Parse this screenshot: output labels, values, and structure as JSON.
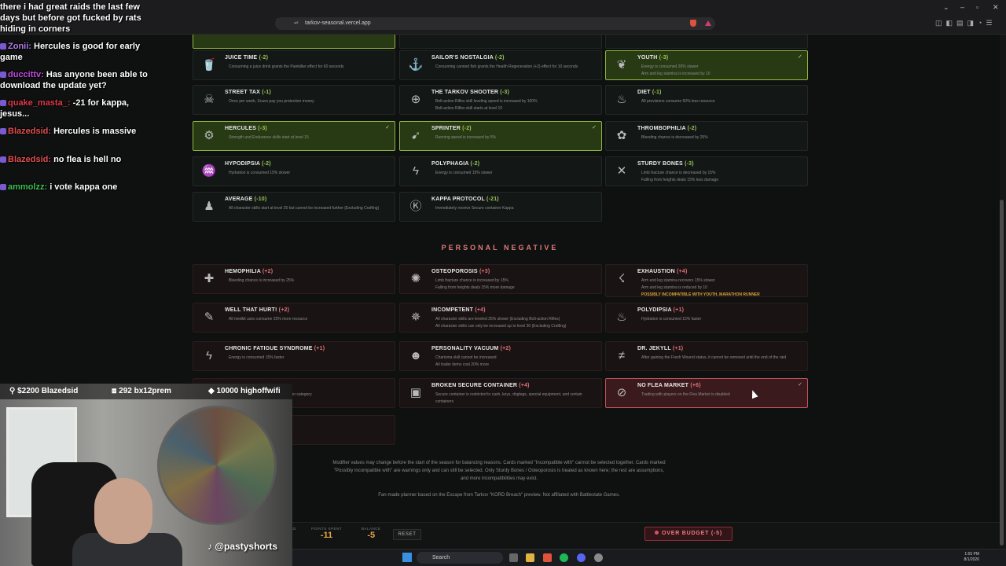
{
  "browser": {
    "url": "tarkov-seasonal.vercel.app"
  },
  "positive_cards": [
    {
      "name": "JUICE TIME",
      "cost": "(-2)",
      "desc": "Consuming a juice drink grants the Painkiller effect for 60 seconds",
      "selected": false,
      "icon": "juice-icon",
      "glyph": "🥤"
    },
    {
      "name": "SAILOR'S NOSTALGIA",
      "cost": "(-2)",
      "desc": "Consuming canned fish grants the Health Regeneration (+2) effect for 10 seconds",
      "selected": false,
      "icon": "anchor-icon",
      "glyph": "⚓"
    },
    {
      "name": "YOUTH",
      "cost": "(-3)",
      "desc": "Energy is consumed 20% slower\nArm and leg stamina is increased by 10",
      "selected": true,
      "icon": "plant-icon",
      "glyph": "❦"
    },
    {
      "name": "STREET TAX",
      "cost": "(-1)",
      "desc": "Once per week, Scavs pay you protection money",
      "selected": false,
      "icon": "scav-icon",
      "glyph": "☠"
    },
    {
      "name": "THE TARKOV SHOOTER",
      "cost": "(-3)",
      "desc": "Bolt-action Rifles skill leveling speed is increased by 100%\nBolt-action Rifles skill starts at level 10",
      "selected": false,
      "icon": "crosshair-icon",
      "glyph": "⊕"
    },
    {
      "name": "DIET",
      "cost": "(-1)",
      "desc": "All provisions consume 50% less resource",
      "selected": false,
      "icon": "food-icon",
      "glyph": "♨"
    },
    {
      "name": "HERCULES",
      "cost": "(-3)",
      "desc": "Strength and Endurance skills start at level 15",
      "selected": true,
      "icon": "muscle-icon",
      "glyph": "⚙"
    },
    {
      "name": "SPRINTER",
      "cost": "(-2)",
      "desc": "Running speed is increased by 5%",
      "selected": true,
      "icon": "runner-icon",
      "glyph": "➹"
    },
    {
      "name": "THROMBOPHILIA",
      "cost": "(-2)",
      "desc": "Bleeding chance is decreased by 25%",
      "selected": false,
      "icon": "blood-icon",
      "glyph": "✿"
    },
    {
      "name": "HYPODIPSIA",
      "cost": "(-2)",
      "desc": "Hydration is consumed 15% slower",
      "selected": false,
      "icon": "water-icon",
      "glyph": "♒"
    },
    {
      "name": "POLYPHAGIA",
      "cost": "(-2)",
      "desc": "Energy is consumed 15% slower",
      "selected": false,
      "icon": "lightning-icon",
      "glyph": "ϟ"
    },
    {
      "name": "STURDY BONES",
      "cost": "(-3)",
      "desc": "Limb fracture chance is decreased by 15%\nFalling from heights deals 15% less damage",
      "selected": false,
      "icon": "bones-icon",
      "glyph": "✕"
    },
    {
      "name": "AVERAGE",
      "cost": "(-10)",
      "desc": "All character skills start at level 25 but cannot be increased further (Excluding Crafting)",
      "selected": false,
      "icon": "person-icon",
      "glyph": "♟"
    },
    {
      "name": "KAPPA PROTOCOL",
      "cost": "(-21)",
      "desc": "Immediately receive Secure container Kappa",
      "selected": false,
      "icon": "kappa-icon",
      "glyph": "Ⓚ"
    }
  ],
  "section_title": "PERSONAL NEGATIVE",
  "negative_cards": [
    {
      "name": "HEMOPHILIA",
      "cost": "(+2)",
      "desc": "Bleeding chance is increased by 25%",
      "selected": false,
      "icon": "blood-drop-icon",
      "glyph": "✚",
      "warn": ""
    },
    {
      "name": "OSTEOPOROSIS",
      "cost": "(+3)",
      "desc": "Limb fracture chance is increased by 15%\nFalling from heights deals 15% more damage",
      "selected": false,
      "icon": "bone-icon",
      "glyph": "✺",
      "warn": ""
    },
    {
      "name": "EXHAUSTION",
      "cost": "(+4)",
      "desc": "Arm and leg stamina recovers 15% slower\nArm and leg stamina is reduced by 10",
      "selected": false,
      "icon": "tired-icon",
      "glyph": "☇",
      "warn": "POSSIBLY INCOMPATIBLE WITH YOUTH, MARATHON RUNNER"
    },
    {
      "name": "WELL THAT HURT!",
      "cost": "(+2)",
      "desc": "All medkit uses consume 25% more resource",
      "selected": false,
      "icon": "bandage-icon",
      "glyph": "✎",
      "warn": ""
    },
    {
      "name": "INCOMPETENT",
      "cost": "(+4)",
      "desc": "All character skills are leveled 25% slower (Excluding Bolt-action Rifles)\nAll character skills can only be increased up to level 30 (Excluding Crafting)",
      "selected": false,
      "icon": "gear-brain-icon",
      "glyph": "✵",
      "warn": ""
    },
    {
      "name": "POLYDIPSIA",
      "cost": "(+1)",
      "desc": "Hydration is consumed 15% faster",
      "selected": false,
      "icon": "thirst-icon",
      "glyph": "♨",
      "warn": ""
    },
    {
      "name": "CHRONIC FATIGUE SYNDROME",
      "cost": "(+1)",
      "desc": "Energy is consumed 15% faster",
      "selected": false,
      "icon": "fatigue-icon",
      "glyph": "ϟ",
      "warn": ""
    },
    {
      "name": "PERSONALITY VACUUM",
      "cost": "(+2)",
      "desc": "Charisma skill cannot be increased\nAll trader items cost 20% more",
      "selected": false,
      "icon": "mask-icon",
      "glyph": "☻",
      "warn": ""
    },
    {
      "name": "DR. JEKYLL",
      "cost": "(+1)",
      "desc": "After gaining the Fresh Wound status, it cannot be removed until the end of the raid",
      "selected": false,
      "icon": "wound-icon",
      "glyph": "≠",
      "warn": ""
    },
    {
      "name": "",
      "cost": "",
      "desc": "ems from the Provisions or Medication category",
      "selected": false,
      "icon": "hidden-card-icon",
      "glyph": "",
      "warn": ""
    },
    {
      "name": "BROKEN SECURE CONTAINER",
      "cost": "(+4)",
      "desc": "Secure container is restricted to cash, keys, dogtags, special equipment, and certain containers",
      "selected": false,
      "icon": "container-icon",
      "glyph": "▣",
      "warn": ""
    },
    {
      "name": "NO FLEA MARKET",
      "cost": "(+6)",
      "desc": "Trading with players on the Flea Market is disabled",
      "selected": true,
      "icon": "no-market-icon",
      "glyph": "⊘",
      "warn": ""
    },
    {
      "name": "",
      "cost": "",
      "desc": "y 1%\ncheaper",
      "selected": false,
      "icon": "hidden-card-icon",
      "glyph": "",
      "warn": ""
    }
  ],
  "footnote_1": "Modifier values may change before the start of the season for balancing reasons. Cards marked \"Incompatible with\" cannot be selected together. Cards marked \"Possibly incompatible with\" are warnings only and can still be selected. Only Sturdy Bones / Osteoporosis is treated as known here; the rest are assumptions, and more incompatibilities may exist.",
  "footnote_2": "Fan-made planner based on the Escape from Tarkov \"KORD Breach\" preview. Not affiliated with Battlestate Games.",
  "bottom": {
    "spent_label": "NED",
    "points_label": "POINTS SPENT",
    "points_value": "-11",
    "balance_label": "BALANCE",
    "balance_value": "-5",
    "reset_label": "RESET",
    "budget_label": "OVER BUDGET (-5)"
  },
  "taskbar": {
    "search": "Search",
    "time": "1:55 PM",
    "date": "8/1/2026"
  },
  "chat": [
    {
      "user": "",
      "text": "there i had great raids the last few days but before got fucked by rats hiding in corners",
      "user_color": "#ffffff"
    },
    {
      "user": "Zonii:",
      "text": "Hercules is good for early game",
      "user_color": "#b07be6"
    },
    {
      "user": "duccittv:",
      "text": "Has anyone been able to download the update yet?",
      "user_color": "#c24be0"
    },
    {
      "user": "quake_masta_:",
      "text": "-21 for kappa, jesus...",
      "user_color": "#e03a4a"
    },
    {
      "user": "Blazedsid:",
      "text": "Hercules is massive",
      "user_color": "#e05050"
    },
    {
      "user": "Blazedsid:",
      "text": "no flea is hell no",
      "user_color": "#e05050"
    },
    {
      "user": "ammolzz:",
      "text": "i vote kappa one",
      "user_color": "#3fbf55"
    }
  ],
  "stream": {
    "goal_1": "$2200 Blazedsid",
    "goal_2": "292 bx12prem",
    "goal_3": "10000 highoffwifi",
    "handle": "@pastyshorts"
  }
}
